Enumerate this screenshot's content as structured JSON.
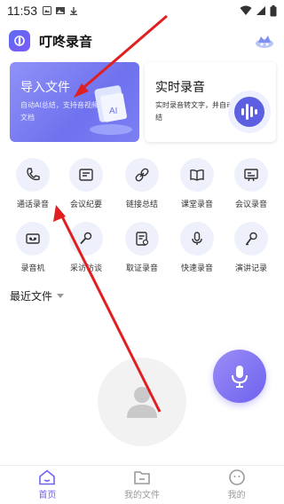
{
  "status_bar": {
    "time": "11:53"
  },
  "app": {
    "title": "叮咚录音"
  },
  "cards": {
    "import": {
      "title": "导入文件",
      "desc": "自动AI总结，支持音视频、文档"
    },
    "realtime": {
      "title": "实时录音",
      "desc": "实时录音转文字，并自动AI总结"
    }
  },
  "grid": [
    {
      "label": "通话录音",
      "icon": "phone-icon"
    },
    {
      "label": "会议纪要",
      "icon": "meeting-notes-icon"
    },
    {
      "label": "链接总结",
      "icon": "link-icon"
    },
    {
      "label": "课堂录音",
      "icon": "book-icon"
    },
    {
      "label": "会议录音",
      "icon": "presentation-icon"
    },
    {
      "label": "录音机",
      "icon": "cassette-icon"
    },
    {
      "label": "采访访谈",
      "icon": "microphone-icon"
    },
    {
      "label": "取证录音",
      "icon": "evidence-icon"
    },
    {
      "label": "快速录音",
      "icon": "mic-icon"
    },
    {
      "label": "演讲记录",
      "icon": "speech-mic-icon"
    }
  ],
  "recent": {
    "title": "最近文件"
  },
  "nav": [
    {
      "label": "首页",
      "icon": "home-icon"
    },
    {
      "label": "我的文件",
      "icon": "folder-icon"
    },
    {
      "label": "我的",
      "icon": "profile-icon"
    }
  ],
  "colors": {
    "accent": "#6c63ee",
    "card_gradient_start": "#8f92f7",
    "card_gradient_end": "#6f72ee",
    "annotation": "#e02020"
  }
}
